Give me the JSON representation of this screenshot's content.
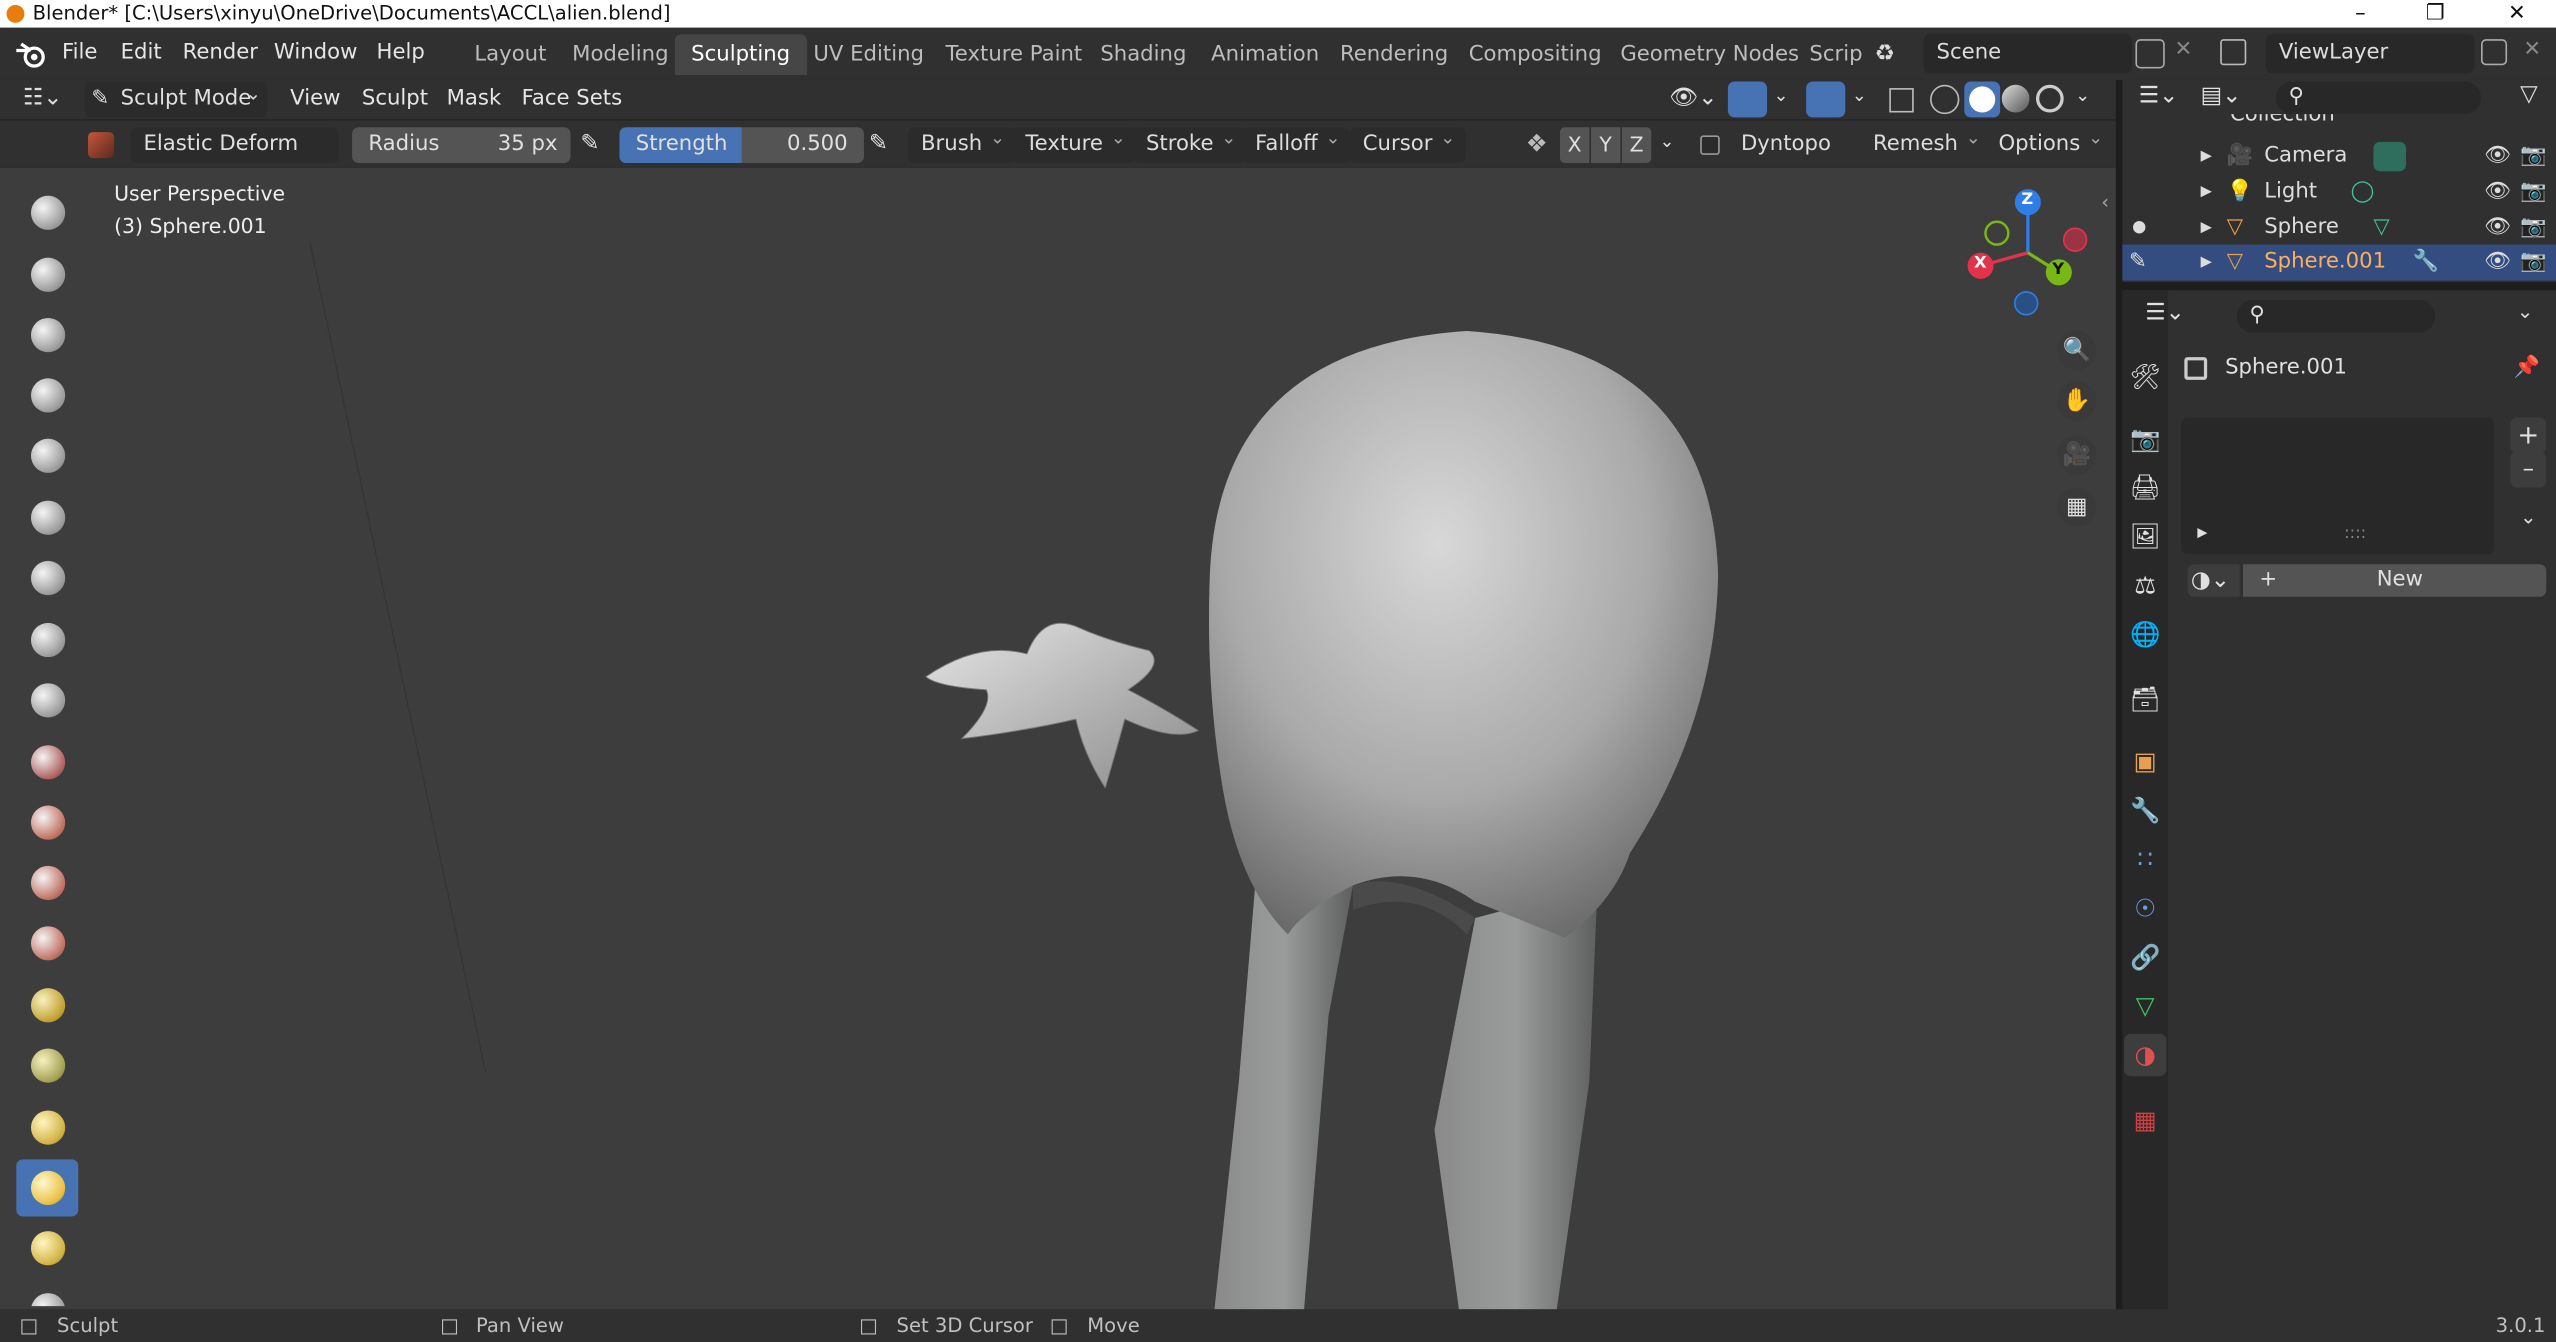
{
  "window": {
    "title": "Blender* [C:\\Users\\xinyu\\OneDrive\\Documents\\ACCL\\alien.blend]",
    "minimize": "–",
    "restore": "❐",
    "close": "✕"
  },
  "menu": {
    "file": "File",
    "edit": "Edit",
    "render": "Render",
    "window": "Window",
    "help": "Help"
  },
  "workspaces": [
    "Layout",
    "Modeling",
    "Sculpting",
    "UV Editing",
    "Texture Paint",
    "Shading",
    "Animation",
    "Rendering",
    "Compositing",
    "Geometry Nodes",
    "Scrip"
  ],
  "active_workspace": "Sculpting",
  "scene": {
    "name": "Scene",
    "view_layer": "ViewLayer"
  },
  "header": {
    "mode": "Sculpt Mode",
    "view": "View",
    "sculpt": "Sculpt",
    "mask": "Mask",
    "face_sets": "Face Sets"
  },
  "tool_settings": {
    "brush_name": "Elastic Deform",
    "radius_label": "Radius",
    "radius_value": "35 px",
    "strength_label": "Strength",
    "strength_value": "0.500",
    "brush": "Brush",
    "texture": "Texture",
    "stroke": "Stroke",
    "falloff": "Falloff",
    "cursor": "Cursor",
    "x": "X",
    "y": "Y",
    "z": "Z",
    "dyntopo": "Dyntopo",
    "remesh": "Remesh",
    "options": "Options"
  },
  "viewport": {
    "perspective": "User Perspective",
    "object": "(3) Sphere.001",
    "gizmo_x": "X",
    "gizmo_y": "Y",
    "gizmo_z": "Z"
  },
  "outliner": {
    "collection": "Collection",
    "items": [
      "Camera",
      "Light",
      "Sphere",
      "Sphere.001"
    ],
    "selected": "Sphere.001"
  },
  "properties": {
    "object_name": "Sphere.001",
    "new_button": "New",
    "plus": "+",
    "minus": "–"
  },
  "status": {
    "sculpt": "Sculpt",
    "pan": "Pan View",
    "cursor": "Set 3D Cursor",
    "move": "Move",
    "version": "3.0.1"
  },
  "colors": {
    "accent": "#4772b3",
    "brand": "#e87d0d",
    "gizmo_x": "#e2334c",
    "gizmo_y": "#77b816",
    "gizmo_z": "#2f7ee6"
  }
}
